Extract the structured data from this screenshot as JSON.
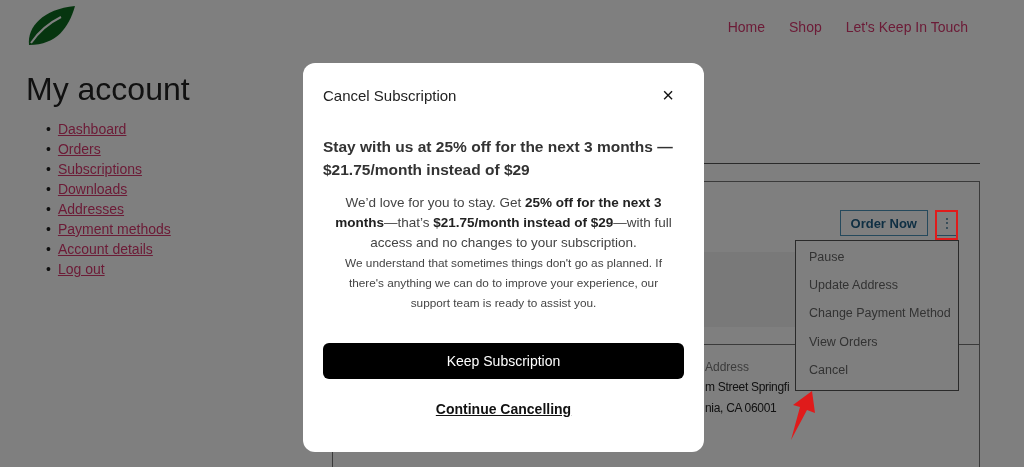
{
  "header": {
    "nav": [
      "Home",
      "Shop",
      "Let's Keep In Touch"
    ]
  },
  "page": {
    "title": "My account",
    "bullet": "•",
    "account_nav": [
      "Dashboard",
      "Orders",
      "Subscriptions",
      "Downloads",
      "Addresses",
      "Payment methods",
      "Account details",
      "Log out"
    ]
  },
  "subscription_card": {
    "order_button": "Order Now",
    "more_button": "⋮",
    "address_label": "Address",
    "address_lines": [
      "m Street Springfi",
      "nia, CA 06001"
    ]
  },
  "actions_menu": {
    "items": [
      "Pause",
      "Update Address",
      "Change Payment Method",
      "View Orders",
      "Cancel"
    ]
  },
  "modal": {
    "title": "Cancel Subscription",
    "close": "×",
    "heading": "Stay with us at 25% off for the next 3 months — $21.75/month instead of $29",
    "offer": "We’d love for you to stay. Get **25% off for the next 3 months**—that’s **$21.75/month instead of $29**—with full access and no changes to your subscription.",
    "support": "We understand that sometimes things don't go as planned. If there's anything we can do to improve your experience, our support team is ready to assist you.",
    "keep_button": "Keep Subscription",
    "continue_link": "Continue Cancelling"
  }
}
